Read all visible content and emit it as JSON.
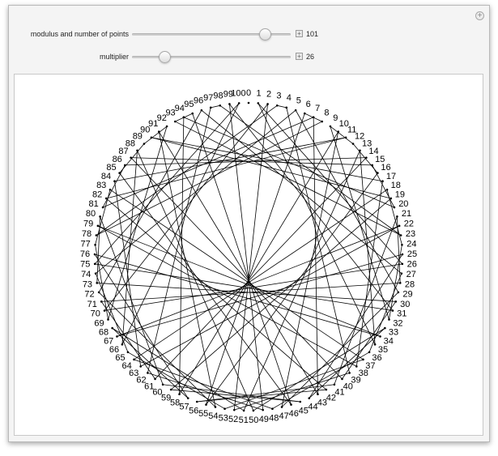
{
  "controls": {
    "modulus": {
      "label": "modulus and number of points",
      "value": "101",
      "min": 2,
      "max": 120,
      "current": 101
    },
    "multiplier": {
      "label": "multiplier",
      "value": "26",
      "min": 2,
      "max": 120,
      "current": 26
    }
  },
  "plot": {
    "modulus": 101,
    "multiplier": 26,
    "line_color": "#000000",
    "label_color": "#000000"
  }
}
